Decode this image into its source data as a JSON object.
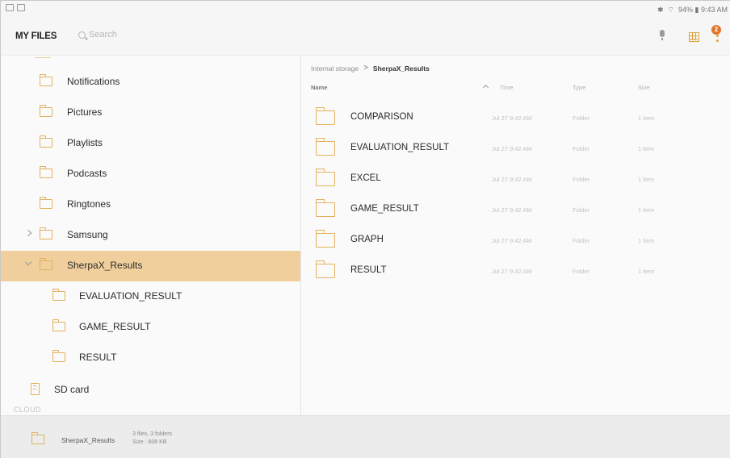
{
  "status_bar": {
    "right_text": "94% ▮ 9:43 AM"
  },
  "app_bar": {
    "title": "MY FILES",
    "search_placeholder": "Search",
    "notification_count": "2"
  },
  "sidebar": {
    "items": [
      {
        "label": "Notifications",
        "expandable": false,
        "selected": false
      },
      {
        "label": "Pictures",
        "expandable": false,
        "selected": false
      },
      {
        "label": "Playlists",
        "expandable": false,
        "selected": false
      },
      {
        "label": "Podcasts",
        "expandable": false,
        "selected": false
      },
      {
        "label": "Ringtones",
        "expandable": false,
        "selected": false
      },
      {
        "label": "Samsung",
        "expandable": true,
        "selected": false
      },
      {
        "label": "SherpaX_Results",
        "expanded": true,
        "selected": true
      },
      {
        "label": "EVALUATION_RESULT",
        "child": true
      },
      {
        "label": "GAME_RESULT",
        "child": true
      },
      {
        "label": "RESULT",
        "child": true
      }
    ],
    "sd_card": "SD card",
    "section_partial": "CLOUD"
  },
  "main": {
    "breadcrumb": {
      "root": "Internal storage",
      "separator": ">",
      "current": "SherpaX_Results"
    },
    "columns": {
      "name": "Name",
      "time": "Time",
      "type": "Type",
      "size": "Size"
    },
    "rows": [
      {
        "name": "COMPARISON",
        "time": "Jul 27 9:42 AM",
        "type": "Folder",
        "size": "1 item"
      },
      {
        "name": "EVALUATION_RESULT",
        "time": "Jul 27 9:42 AM",
        "type": "Folder",
        "size": "1 item"
      },
      {
        "name": "EXCEL",
        "time": "Jul 27 9:42 AM",
        "type": "Folder",
        "size": "1 item"
      },
      {
        "name": "GAME_RESULT",
        "time": "Jul 27 9:42 AM",
        "type": "Folder",
        "size": "1 item"
      },
      {
        "name": "GRAPH",
        "time": "Jul 27 9:42 AM",
        "type": "Folder",
        "size": "1 item"
      },
      {
        "name": "RESULT",
        "time": "Jul 27 9:42 AM",
        "type": "Folder",
        "size": "1 item"
      }
    ]
  },
  "bottom_bar": {
    "folder_name": "SherpaX_Results",
    "meta_line1": "3 files, 3 folders",
    "meta_line2": "Size : 608 KB"
  },
  "colors": {
    "accent": "#e3b25f",
    "selected_bg": "#f0cf9d",
    "badge": "#e2742c"
  }
}
